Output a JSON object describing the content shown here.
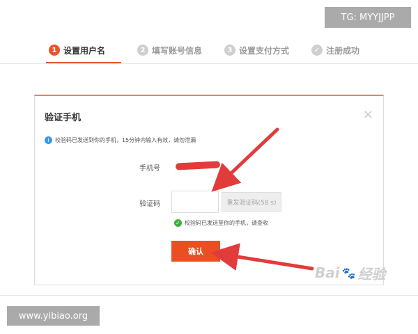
{
  "steps": [
    {
      "num": "1",
      "label": "设置用户名",
      "state": "active"
    },
    {
      "num": "2",
      "label": "填写账号信息",
      "state": "pending"
    },
    {
      "num": "3",
      "label": "设置支付方式",
      "state": "pending"
    },
    {
      "num": "✓",
      "label": "注册成功",
      "state": "pending"
    }
  ],
  "watermark_top": "TG: MYYJJPP",
  "dialog": {
    "title": "验证手机",
    "close_glyph": "×",
    "info_icon": "i",
    "info_text": "校验码已发送到你的手机，15分钟内输入有效，请勿泄漏",
    "phone_label": "手机号",
    "code_label": "验证码",
    "code_value": "",
    "resend_label": "重发验证码(58 s)",
    "success_icon": "✓",
    "success_text": "校验码已发送至你的手机，请查收",
    "confirm_label": "确认"
  },
  "baidu_watermark": {
    "left": "Bai",
    "paw": "🐾",
    "right": "经验"
  },
  "watermark_bottom": "www.yibiao.org",
  "colors": {
    "accent": "#e8542a",
    "info": "#3b9ae8",
    "success": "#3fae3f",
    "arrow": "#e23b3b"
  }
}
